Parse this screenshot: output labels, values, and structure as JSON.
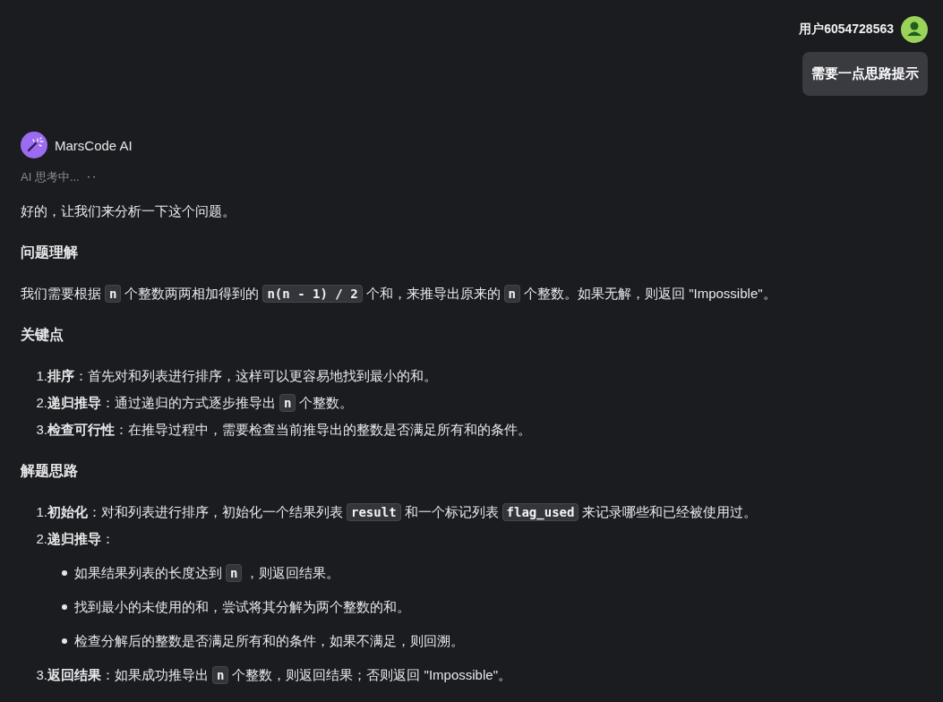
{
  "user_message": {
    "username": "用户6054728563",
    "text": "需要一点思路提示"
  },
  "assistant": {
    "name": "MarsCode AI",
    "status": "AI 思考中...",
    "status_dots": "··",
    "blocks": [
      {
        "kind": "paragraph",
        "segments": [
          {
            "kind": "text",
            "text": "好的，让我们来分析一下这个问题。"
          }
        ]
      },
      {
        "kind": "heading",
        "text": "问题理解"
      },
      {
        "kind": "paragraph",
        "segments": [
          {
            "kind": "text",
            "text": "我们需要根据"
          },
          {
            "kind": "code",
            "text": "n"
          },
          {
            "kind": "text",
            "text": "个整数两两相加得到的"
          },
          {
            "kind": "code",
            "text": "n(n - 1) / 2"
          },
          {
            "kind": "text",
            "text": "个和，来推导出原来的"
          },
          {
            "kind": "code",
            "text": "n"
          },
          {
            "kind": "text",
            "text": "个整数。如果无解，则返回 \"Impossible\"。"
          }
        ]
      },
      {
        "kind": "heading",
        "text": "关键点"
      },
      {
        "kind": "list",
        "items": [
          {
            "number": "1.",
            "segments": [
              {
                "kind": "text",
                "text": "**排序**：首先对和列表进行排序，这样可以更容易地找到最小的和。"
              }
            ]
          },
          {
            "number": "2.",
            "segments": [
              {
                "kind": "text",
                "text": "**递归推导**：通过递归的方式逐步推导出"
              },
              {
                "kind": "code",
                "text": "n"
              },
              {
                "kind": "text",
                "text": "个整数。"
              }
            ]
          },
          {
            "number": "3.",
            "segments": [
              {
                "kind": "text",
                "text": "**检查可行性**：在推导过程中，需要检查当前推导出的整数是否满足所有和的条件。"
              }
            ]
          }
        ]
      },
      {
        "kind": "heading",
        "text": "解题思路"
      },
      {
        "kind": "list",
        "items": [
          {
            "number": "1.",
            "segments": [
              {
                "kind": "text",
                "text": "**初始化**：对和列表进行排序，初始化一个结果列表"
              },
              {
                "kind": "code",
                "text": "result"
              },
              {
                "kind": "text",
                "text": "和一个标记列表"
              },
              {
                "kind": "code",
                "text": "flag_used"
              },
              {
                "kind": "text",
                "text": "来记录哪些和已经被使用过。"
              }
            ]
          },
          {
            "number": "2.",
            "segments": [
              {
                "kind": "text",
                "text": "**递归推导**："
              }
            ],
            "children": [
              {
                "segments": [
                  {
                    "kind": "text",
                    "text": "如果结果列表的长度达到"
                  },
                  {
                    "kind": "code",
                    "text": "n"
                  },
                  {
                    "kind": "text",
                    "text": "，则返回结果。"
                  }
                ]
              },
              {
                "segments": [
                  {
                    "kind": "text",
                    "text": "找到最小的未使用的和，尝试将其分解为两个整数的和。"
                  }
                ]
              },
              {
                "segments": [
                  {
                    "kind": "text",
                    "text": "检查分解后的整数是否满足所有和的条件，如果不满足，则回溯。"
                  }
                ]
              }
            ]
          },
          {
            "number": "3.",
            "segments": [
              {
                "kind": "text",
                "text": "**返回结果**：如果成功推导出"
              },
              {
                "kind": "code",
                "text": "n"
              },
              {
                "kind": "text",
                "text": "个整数，则返回结果；否则返回 \"Impossible\"。"
              }
            ]
          }
        ]
      }
    ]
  }
}
